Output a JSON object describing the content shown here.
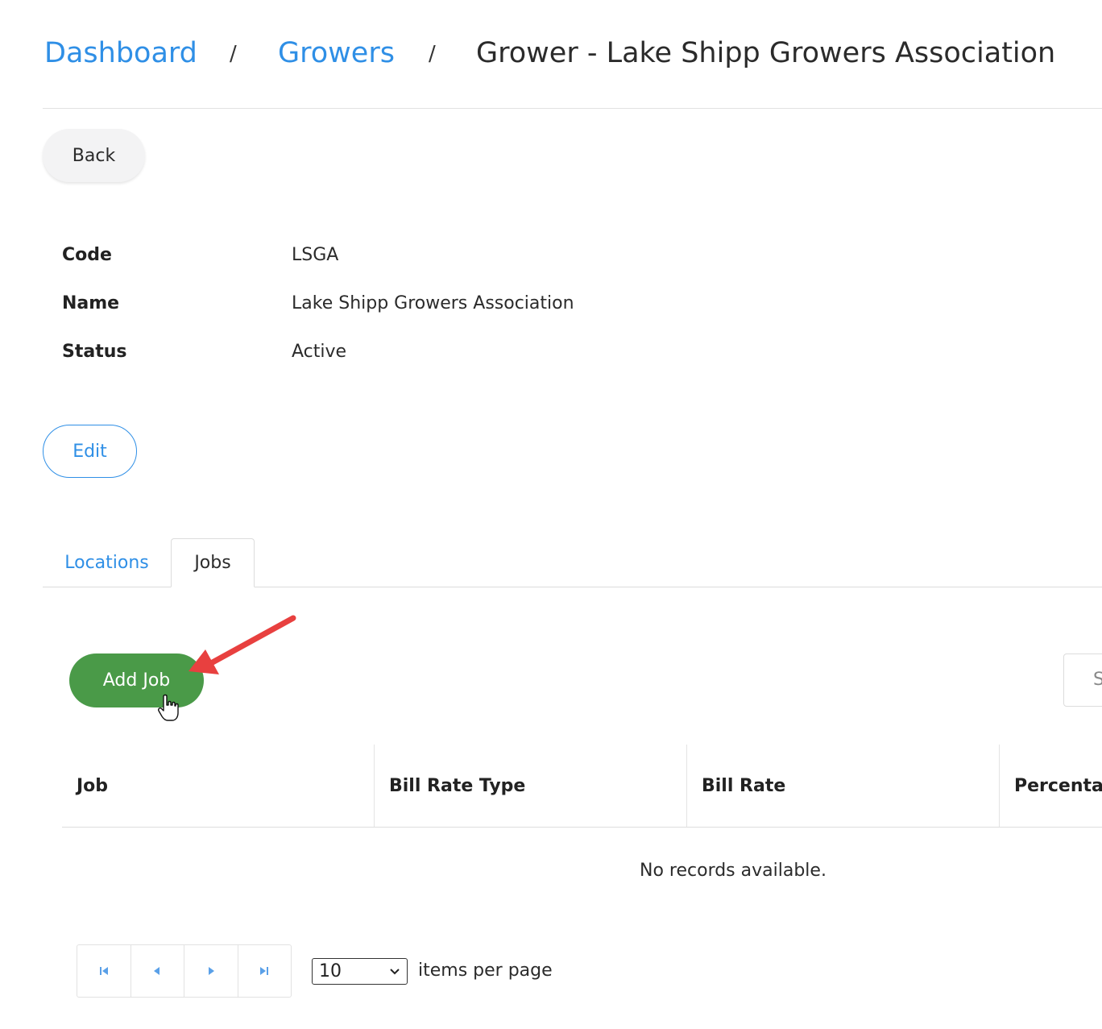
{
  "breadcrumb": {
    "dashboard": "Dashboard",
    "separator": "/",
    "growers": "Growers",
    "current": "Grower - Lake Shipp Growers Association"
  },
  "back_label": "Back",
  "details": [
    {
      "label": "Code",
      "value": "LSGA"
    },
    {
      "label": "Name",
      "value": "Lake Shipp Growers Association"
    },
    {
      "label": "Status",
      "value": "Active"
    }
  ],
  "edit_label": "Edit",
  "tabs": [
    {
      "label": "Locations",
      "active": false
    },
    {
      "label": "Jobs",
      "active": true
    }
  ],
  "jobs": {
    "add_label": "Add Job",
    "search_placeholder": "S",
    "columns": [
      "Job",
      "Bill Rate Type",
      "Bill Rate",
      "Percentag"
    ],
    "empty_text": "No records available.",
    "pager": {
      "page_size": "10",
      "items_per_page": "items per page"
    }
  },
  "colors": {
    "link": "#2f8fe6",
    "add_button": "#4a9a48",
    "annotation_arrow": "#e8403f"
  },
  "icons": {
    "first": "page-first-icon",
    "prev": "page-prev-icon",
    "next": "page-next-icon",
    "last": "page-last-icon",
    "dropdown": "chevron-down-icon",
    "cursor": "hand-pointer-icon",
    "annotation": "red-arrow-annotation"
  }
}
